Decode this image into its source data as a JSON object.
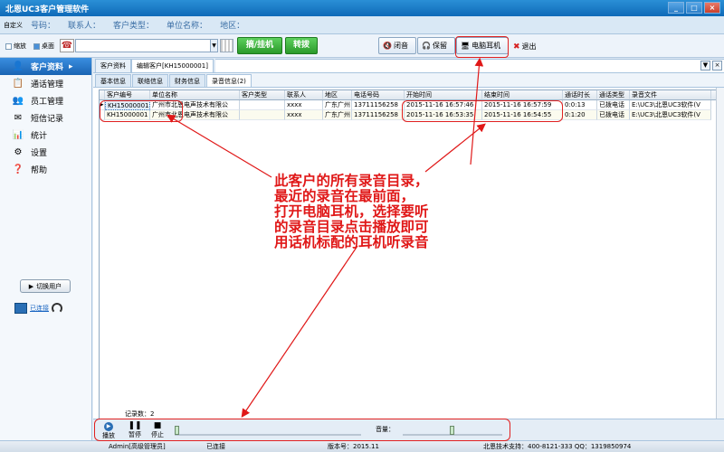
{
  "window": {
    "title": "北恩UC3客户管理软件",
    "controls": [
      "_",
      "□",
      "×"
    ]
  },
  "infobar": {
    "custom_label": "自定义",
    "fields": [
      "号码：",
      "联系人：",
      "客户类型：",
      "单位名称：",
      "地区："
    ]
  },
  "toolbar": {
    "shrink_label": "缩放",
    "desktop_label": "桌面",
    "phone_input_value": "",
    "dial_label": "摘/挂机",
    "transfer_label": "转拨",
    "mute_label": "闭音",
    "hold_label": "保留",
    "headset_label": "电脑耳机",
    "exit_label": "退出"
  },
  "sidebar": {
    "items": [
      {
        "label": "客户资料",
        "icon": "customer-icon",
        "active": true
      },
      {
        "label": "通话管理",
        "icon": "call-icon"
      },
      {
        "label": "员工管理",
        "icon": "staff-icon"
      },
      {
        "label": "短信记录",
        "icon": "sms-icon"
      },
      {
        "label": "统计",
        "icon": "stats-icon"
      },
      {
        "label": "设置",
        "icon": "settings-icon"
      },
      {
        "label": "帮助",
        "icon": "help-icon"
      }
    ],
    "switch_user_label": "切换用户",
    "connection_status": "已连接"
  },
  "main": {
    "tabs": [
      {
        "label": "客户资料",
        "active": false
      },
      {
        "label": "编辑客户[KH15000001]",
        "active": true
      }
    ],
    "subtabs": [
      {
        "label": "基本信息",
        "active": false
      },
      {
        "label": "联络信息",
        "active": false
      },
      {
        "label": "财务信息",
        "active": false
      },
      {
        "label": "录音信息(2)",
        "active": true
      }
    ],
    "grid": {
      "columns": [
        "客户编号",
        "单位名称",
        "客户类型",
        "联系人",
        "地区",
        "电话号码",
        "开始时间",
        "结束时间",
        "通话时长",
        "通话类型",
        "录音文件"
      ],
      "rows": [
        [
          "KH15000001",
          "广州市北恩电声技术有限公",
          "",
          "xxxx",
          "广东广州",
          "13711156258",
          "2015-11-16 16:57:46",
          "2015-11-16 16:57:59",
          "0:0:13",
          "已拨电话",
          "E:\\UC3\\北恩UC3软件(V"
        ],
        [
          "KH15000001",
          "广州市北恩电声技术有限公",
          "",
          "xxxx",
          "广东广州",
          "13711156258",
          "2015-11-16 16:53:35",
          "2015-11-16 16:54:55",
          "0:1:20",
          "已拨电话",
          "E:\\UC3\\北恩UC3软件(V"
        ]
      ],
      "selected_row": 0
    },
    "record_count_label": "记录数：2"
  },
  "player": {
    "play_label": "播放",
    "pause_label": "暂停",
    "stop_label": "停止",
    "volume_label": "音量：",
    "progress": 0.0,
    "volume": 0.5
  },
  "statusbar": {
    "user": "Admin[高级管理员]",
    "connection": "已连接",
    "version": "版本号：2015.11",
    "support": "北恩技术支持：400-8121-333 QQ：1319850974"
  },
  "annotation": {
    "lines": [
      "此客户的所有录音目录，",
      "最近的录音在最前面，",
      "打开电脑耳机，选择要听",
      "的录音目录点击播放即可",
      "用话机标配的耳机听录音"
    ],
    "color": "#e01818"
  }
}
